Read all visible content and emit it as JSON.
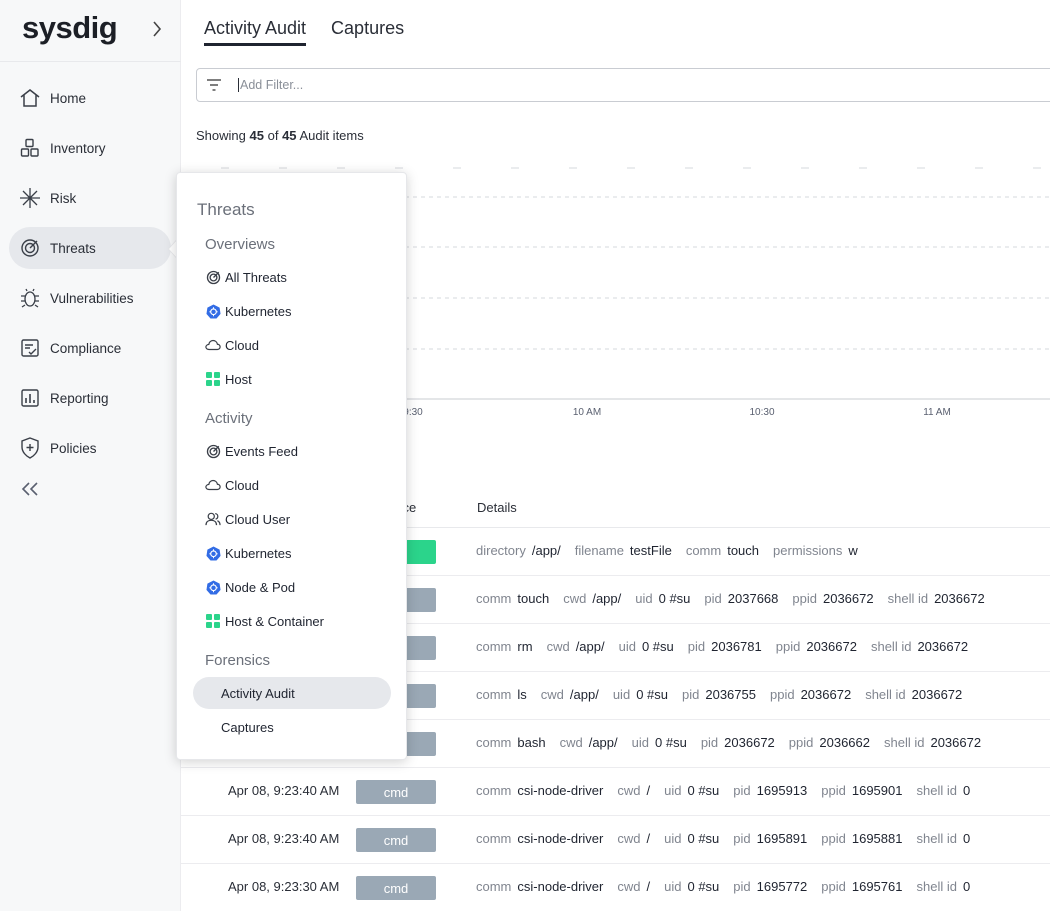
{
  "app": {
    "logo_text": "sysdig"
  },
  "sidebar": {
    "items": [
      {
        "label": "Home",
        "icon": "home-icon"
      },
      {
        "label": "Inventory",
        "icon": "inventory-icon"
      },
      {
        "label": "Risk",
        "icon": "risk-icon"
      },
      {
        "label": "Threats",
        "icon": "threats-icon",
        "active": true
      },
      {
        "label": "Vulnerabilities",
        "icon": "bug-icon"
      },
      {
        "label": "Compliance",
        "icon": "compliance-icon"
      },
      {
        "label": "Reporting",
        "icon": "reporting-icon"
      },
      {
        "label": "Policies",
        "icon": "shield-plus-icon"
      }
    ]
  },
  "tabs": [
    {
      "label": "Activity Audit",
      "active": true
    },
    {
      "label": "Captures",
      "active": false
    }
  ],
  "filter": {
    "placeholder": "Add Filter..."
  },
  "summary": {
    "prefix": "Showing",
    "shown": "45",
    "middle": "of",
    "total": "45",
    "suffix": "Audit items"
  },
  "chart_data": {
    "type": "bar",
    "x_ticks": [
      "9:30",
      "10 AM",
      "10:30",
      "11 AM"
    ],
    "series": [],
    "grid": true
  },
  "table": {
    "columns": {
      "source": "Source",
      "details": "Details"
    },
    "rows": [
      {
        "time": "",
        "source": "",
        "source_color": "#2bd48b",
        "details": [
          [
            "directory",
            "/app/"
          ],
          [
            "filename",
            "testFile"
          ],
          [
            "comm",
            "touch"
          ],
          [
            "permissions",
            "w"
          ]
        ]
      },
      {
        "time": "",
        "source": "",
        "source_color": "#9aa8b5",
        "details": [
          [
            "comm",
            "touch"
          ],
          [
            "cwd",
            "/app/"
          ],
          [
            "uid",
            "0 #su"
          ],
          [
            "pid",
            "2037668"
          ],
          [
            "ppid",
            "2036672"
          ],
          [
            "shell id",
            "2036672"
          ]
        ]
      },
      {
        "time": "",
        "source": "",
        "source_color": "#9aa8b5",
        "details": [
          [
            "comm",
            "rm"
          ],
          [
            "cwd",
            "/app/"
          ],
          [
            "uid",
            "0 #su"
          ],
          [
            "pid",
            "2036781"
          ],
          [
            "ppid",
            "2036672"
          ],
          [
            "shell id",
            "2036672"
          ]
        ]
      },
      {
        "time": "",
        "source": "",
        "source_color": "#9aa8b5",
        "details": [
          [
            "comm",
            "ls"
          ],
          [
            "cwd",
            "/app/"
          ],
          [
            "uid",
            "0 #su"
          ],
          [
            "pid",
            "2036755"
          ],
          [
            "ppid",
            "2036672"
          ],
          [
            "shell id",
            "2036672"
          ]
        ]
      },
      {
        "time": "",
        "source": "",
        "source_color": "#9aa8b5",
        "details": [
          [
            "comm",
            "bash"
          ],
          [
            "cwd",
            "/app/"
          ],
          [
            "uid",
            "0 #su"
          ],
          [
            "pid",
            "2036672"
          ],
          [
            "ppid",
            "2036662"
          ],
          [
            "shell id",
            "2036672"
          ]
        ]
      },
      {
        "time": "Apr 08, 9:23:40 AM",
        "source": "cmd",
        "source_color": "#9aa8b5",
        "details": [
          [
            "comm",
            "csi-node-driver"
          ],
          [
            "cwd",
            "/"
          ],
          [
            "uid",
            "0 #su"
          ],
          [
            "pid",
            "1695913"
          ],
          [
            "ppid",
            "1695901"
          ],
          [
            "shell id",
            "0"
          ]
        ]
      },
      {
        "time": "Apr 08, 9:23:40 AM",
        "source": "cmd",
        "source_color": "#9aa8b5",
        "details": [
          [
            "comm",
            "csi-node-driver"
          ],
          [
            "cwd",
            "/"
          ],
          [
            "uid",
            "0 #su"
          ],
          [
            "pid",
            "1695891"
          ],
          [
            "ppid",
            "1695881"
          ],
          [
            "shell id",
            "0"
          ]
        ]
      },
      {
        "time": "Apr 08, 9:23:30 AM",
        "source": "cmd",
        "source_color": "#9aa8b5",
        "details": [
          [
            "comm",
            "csi-node-driver"
          ],
          [
            "cwd",
            "/"
          ],
          [
            "uid",
            "0 #su"
          ],
          [
            "pid",
            "1695772"
          ],
          [
            "ppid",
            "1695761"
          ],
          [
            "shell id",
            "0"
          ]
        ]
      }
    ]
  },
  "popover": {
    "title": "Threats",
    "sections": [
      {
        "label": "Overviews",
        "items": [
          {
            "label": "All Threats",
            "icon": "threats-icon"
          },
          {
            "label": "Kubernetes",
            "icon": "kubernetes-icon"
          },
          {
            "label": "Cloud",
            "icon": "cloud-icon"
          },
          {
            "label": "Host",
            "icon": "host-icon"
          }
        ]
      },
      {
        "label": "Activity",
        "items": [
          {
            "label": "Events Feed",
            "icon": "threats-icon"
          },
          {
            "label": "Cloud",
            "icon": "cloud-icon"
          },
          {
            "label": "Cloud User",
            "icon": "users-icon"
          },
          {
            "label": "Kubernetes",
            "icon": "kubernetes-icon"
          },
          {
            "label": "Node & Pod",
            "icon": "kubernetes-icon"
          },
          {
            "label": "Host & Container",
            "icon": "host-icon"
          }
        ]
      },
      {
        "label": "Forensics",
        "items": [
          {
            "label": "Activity Audit",
            "active": true
          },
          {
            "label": "Captures"
          }
        ]
      }
    ]
  },
  "colors": {
    "accent_green": "#2bd48b",
    "badge_gray": "#9aa8b5",
    "k8s_blue": "#326ce5"
  }
}
